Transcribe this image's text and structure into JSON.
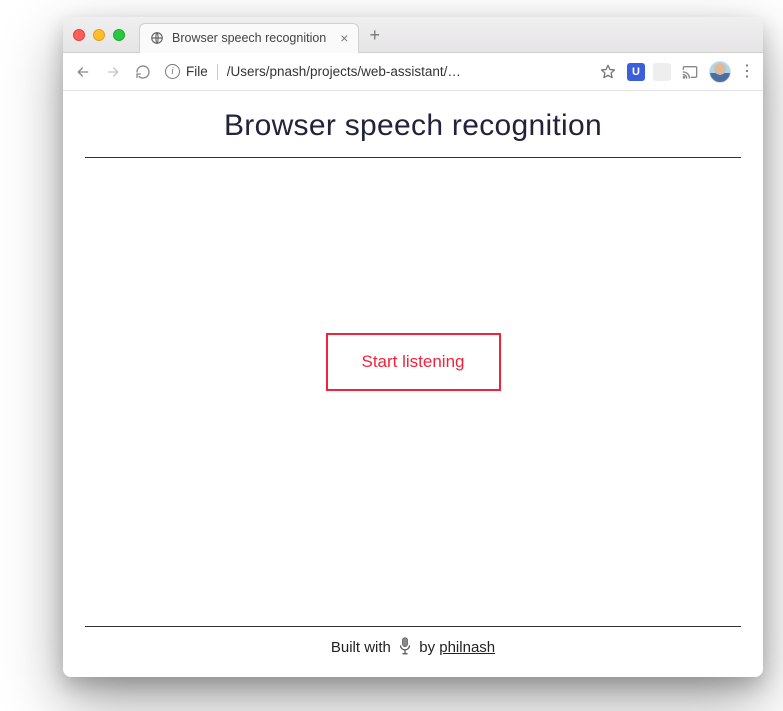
{
  "tab": {
    "title": "Browser speech recognition"
  },
  "addressbar": {
    "protocol_label": "File",
    "path": "/Users/pnash/projects/web-assistant/…"
  },
  "extension": {
    "badge_letter": "U"
  },
  "page": {
    "heading": "Browser speech recognition",
    "button_label": "Start listening",
    "footer_prefix": "Built with ",
    "footer_by": " by ",
    "footer_author": "philnash"
  }
}
